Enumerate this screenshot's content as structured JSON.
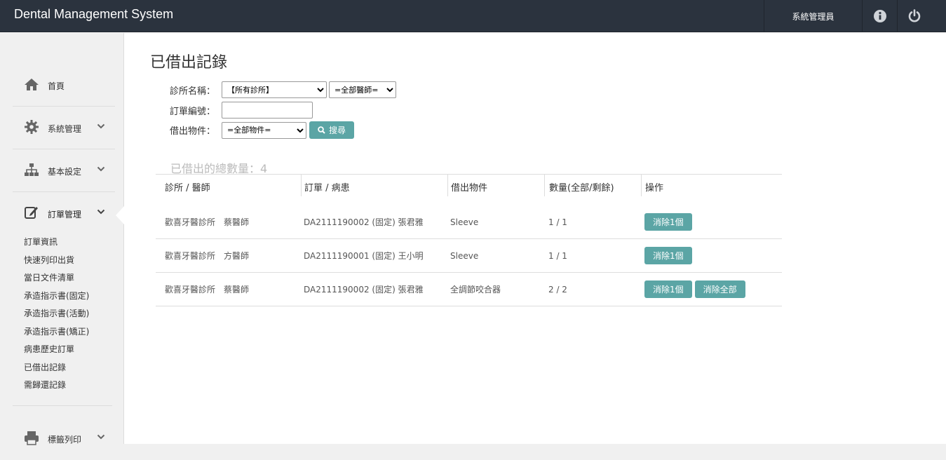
{
  "app": {
    "title": "Dental Management System"
  },
  "topbar": {
    "user": "系統管理員"
  },
  "sidebar": {
    "sections": [
      {
        "label": "首頁",
        "icon": "home-icon",
        "chevron": false
      },
      {
        "label": "系統管理",
        "icon": "gear-icon",
        "chevron": true
      },
      {
        "label": "基本設定",
        "icon": "sitemap-icon",
        "chevron": true
      },
      {
        "label": "訂單管理",
        "icon": "edit-icon",
        "chevron": true
      },
      {
        "label": "標籤列印",
        "icon": "printer-icon",
        "chevron": true
      }
    ],
    "subitems": [
      "訂單資訊",
      "快速列印出貨",
      "當日文件清單",
      "承造指示書(固定)",
      "承造指示書(活動)",
      "承造指示書(矯正)",
      "病患歷史訂單",
      "已借出記錄",
      "需歸還記錄"
    ]
  },
  "page": {
    "title": "已借出記錄",
    "form": {
      "clinic_label": "診所名稱：",
      "clinic_value": "【所有診所】",
      "doctor_value": "=全部醫師=",
      "order_label": "訂單編號：",
      "order_value": "",
      "item_label": "借出物件：",
      "item_value": "=全部物件=",
      "search_label": "搜尋"
    },
    "total": "已借出的總數量：4"
  },
  "table": {
    "headers": [
      "診所 / 醫師",
      "訂單 / 病患",
      "借出物件",
      "數量(全部/剩餘)",
      "操作"
    ],
    "rows": [
      {
        "clinic": "歡喜牙醫診所　蔡醫師",
        "order": "DA2111190002 (固定) 張君雅",
        "item": "Sleeve",
        "qty": "1 / 1",
        "actions": [
          "消除1個"
        ]
      },
      {
        "clinic": "歡喜牙醫診所　方醫師",
        "order": "DA2111190001 (固定) 王小明",
        "item": "Sleeve",
        "qty": "1 / 1",
        "actions": [
          "消除1個"
        ]
      },
      {
        "clinic": "歡喜牙醫診所　蔡醫師",
        "order": "DA2111190002 (固定) 張君雅",
        "item": "全調節咬合器",
        "qty": "2 / 2",
        "actions": [
          "消除1個",
          "消除全部"
        ]
      }
    ]
  },
  "colors": {
    "topbar": "#2b333e",
    "accent": "#5ba5a5"
  }
}
